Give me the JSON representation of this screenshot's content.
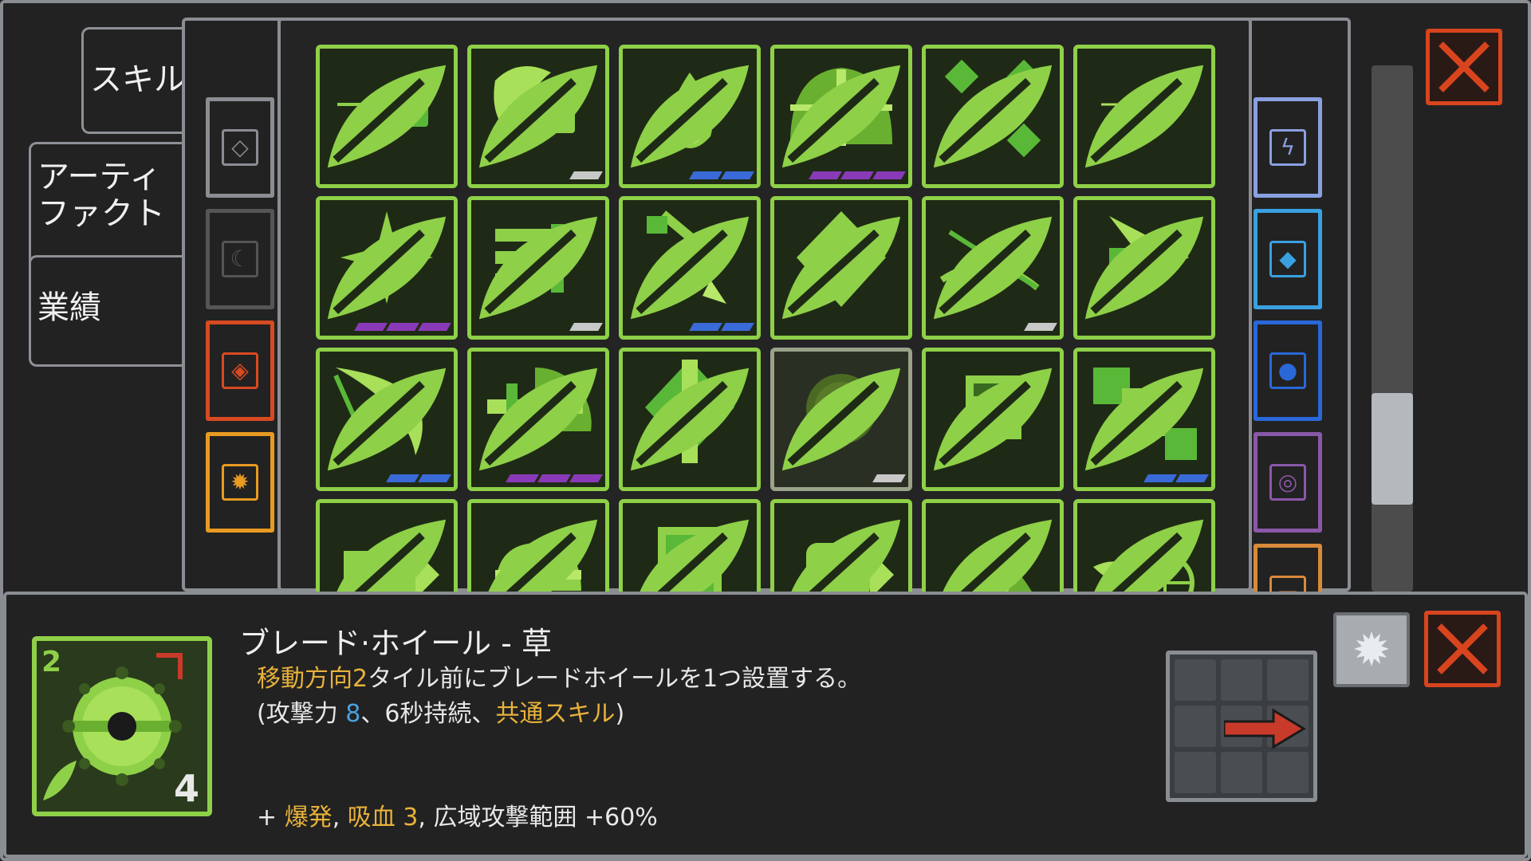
{
  "tabs": [
    {
      "label": "スキル"
    },
    {
      "label": "アーティファクト"
    },
    {
      "label": "業績"
    }
  ],
  "left_filters": [
    {
      "name": "diamond-filter",
      "icon": "◇",
      "color": "#8a8d92"
    },
    {
      "name": "moon-filter",
      "icon": "☾",
      "color": "#555555"
    },
    {
      "name": "fire-filter",
      "icon": "◈",
      "color": "#d84a22"
    },
    {
      "name": "sun-filter",
      "icon": "✹",
      "color": "#e89a22"
    }
  ],
  "right_filters": [
    {
      "name": "lightning-filter",
      "icon": "ϟ",
      "color": "#8aa0e0"
    },
    {
      "name": "gem-filter",
      "icon": "◆",
      "color": "#3aa0e0"
    },
    {
      "name": "water-filter",
      "icon": "●",
      "color": "#2a68d8"
    },
    {
      "name": "vortex-filter",
      "icon": "◎",
      "color": "#8a58a8"
    },
    {
      "name": "card-filter",
      "icon": "▭",
      "color": "#d88a3a"
    }
  ],
  "skills": [
    {
      "id": "fist-dash",
      "rarity": [],
      "selected": false
    },
    {
      "id": "crescent-fist",
      "rarity": [
        "#c8c8c8"
      ],
      "selected": false
    },
    {
      "id": "flame-drop",
      "rarity": [
        "#3a6ad8",
        "#3a6ad8"
      ],
      "selected": false
    },
    {
      "id": "shield-dome",
      "rarity": [
        "#8a3ab8",
        "#8a3ab8",
        "#8a3ab8"
      ],
      "selected": false
    },
    {
      "id": "crystal-burst",
      "rarity": [],
      "selected": false
    },
    {
      "id": "bullet-shot",
      "rarity": [],
      "selected": false
    },
    {
      "id": "star-burst",
      "rarity": [
        "#8a3ab8",
        "#8a3ab8",
        "#8a3ab8"
      ],
      "selected": false
    },
    {
      "id": "triple-blade",
      "rarity": [
        "#c8c8c8"
      ],
      "selected": false
    },
    {
      "id": "falling-sword",
      "rarity": [
        "#3a6ad8",
        "#3a6ad8"
      ],
      "selected": false
    },
    {
      "id": "eye-orb",
      "rarity": [],
      "selected": false
    },
    {
      "id": "bow-arrow",
      "rarity": [
        "#c8c8c8"
      ],
      "selected": false
    },
    {
      "id": "arrow-rush",
      "rarity": [],
      "selected": false
    },
    {
      "id": "crescent-slash",
      "rarity": [
        "#3a6ad8",
        "#3a6ad8"
      ],
      "selected": false
    },
    {
      "id": "sword-arc",
      "rarity": [
        "#8a3ab8",
        "#8a3ab8",
        "#8a3ab8"
      ],
      "selected": false
    },
    {
      "id": "diamond-sword",
      "rarity": [],
      "selected": false
    },
    {
      "id": "blade-wheel",
      "rarity": [
        "#c8c8c8"
      ],
      "selected": true
    },
    {
      "id": "calculator",
      "rarity": [],
      "selected": false
    },
    {
      "id": "gem-chain",
      "rarity": [
        "#3a6ad8",
        "#3a6ad8"
      ],
      "selected": false
    },
    {
      "id": "box-missile",
      "rarity": [],
      "selected": false
    },
    {
      "id": "dome-missile",
      "rarity": [],
      "selected": false
    },
    {
      "id": "mirror-card",
      "rarity": [],
      "selected": false
    },
    {
      "id": "fist-punch",
      "rarity": [],
      "selected": false
    },
    {
      "id": "nature-burst",
      "rarity": [],
      "selected": false
    },
    {
      "id": "target-shot",
      "rarity": [],
      "selected": false
    }
  ],
  "scroll_position": 0.79,
  "detail": {
    "name": "ブレード·ホイール - 草",
    "cost": "2",
    "level": "4",
    "line1_highlight": "移動方向2",
    "line1_rest": "タイル前にブレードホイールを1つ設置する。",
    "line2_a": "(攻撃力 ",
    "line2_atk": "8",
    "line2_b": "、6秒持続、",
    "line2_common": "共通スキル",
    "line2_c": ")",
    "line3_plus": "+ ",
    "line3_burst": "爆発",
    "line3_sep1": ", ",
    "line3_drain": "吸血 3",
    "line3_sep2": ", 広域攻撃範囲 +60%"
  },
  "colors": {
    "accent_green": "#8ed048",
    "close_red": "#d8441e",
    "highlight_yellow": "#e8b23a",
    "highlight_blue": "#4aa0e0"
  }
}
